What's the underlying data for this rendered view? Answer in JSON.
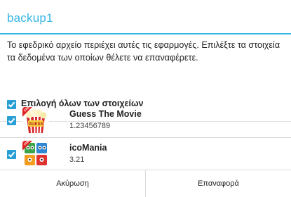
{
  "dialog": {
    "title": "backup1",
    "message": "Το εφεδρικό αρχείο περιέχει αυτές τις εφαρμογές. Επιλέξτε τα στοιχεία τα δεδομένα των οποίων θέλετε να επαναφέρετε.",
    "select_all": {
      "label": "Επιλογή όλων των στοιχείων",
      "checked": true
    }
  },
  "apps": [
    {
      "name": "Guess The Movie",
      "version": "1.23456789",
      "checked": true,
      "icon": "guess-the-movie-app-icon"
    },
    {
      "name": "icoMania",
      "version": "3.21",
      "checked": true,
      "icon": "icomania-app-icon"
    }
  ],
  "buttons": {
    "cancel": "Ακύρωση",
    "restore": "Επαναφορά"
  },
  "colors": {
    "accent": "#33b5e5",
    "checkbox": "#2a9fd6",
    "divider": "#dcdcdc"
  }
}
